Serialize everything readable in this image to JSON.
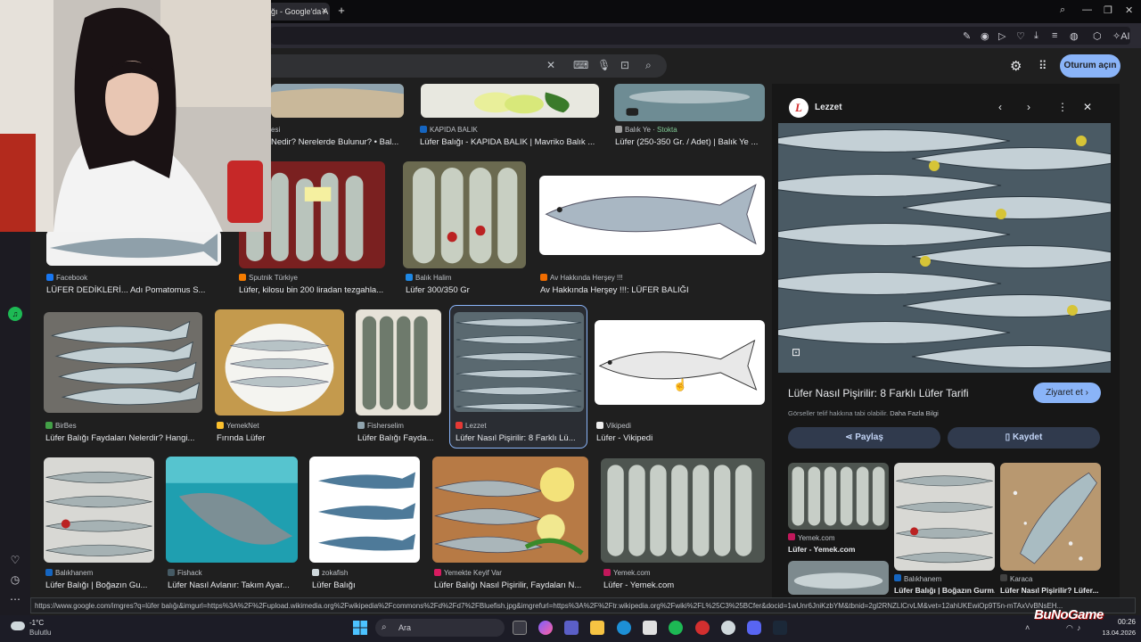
{
  "browser": {
    "tab_title": "ğı - Google'da A",
    "new_tab": "+",
    "sidebar_extra": "AI"
  },
  "google": {
    "signin_label": "Oturum açın"
  },
  "results": [
    {
      "source": "esi",
      "caption": "Nedir? Nerelerde Bulunur? • Bal..."
    },
    {
      "source": "KAPIDA BALIK",
      "caption": "Lüfer Balığı - KAPIDA BALIK | Mavriko Balık ..."
    },
    {
      "source": "Balık Ye",
      "source_extra": "Stokta",
      "caption": "Lüfer (250-350 Gr. / Adet) | Balık Ye ..."
    },
    {
      "source": "Facebook",
      "caption": "LÜFER DEDİKLERİ... Adı Pomatomus S..."
    },
    {
      "source": "Sputnik Türkiye",
      "caption": "Lüfer, kilosu bin 200 liradan tezgahla..."
    },
    {
      "source": "Balık Halim",
      "caption": "Lüfer 300/350 Gr"
    },
    {
      "source": "Av Hakkında Herşey !!!",
      "caption": "Av Hakkında Herşey !!!: LÜFER BALIĞI"
    },
    {
      "source": "BirBes",
      "caption": "Lüfer Balığı Faydaları Nelerdir? Hangi..."
    },
    {
      "source": "YemekNet",
      "caption": "Fırında Lüfer"
    },
    {
      "source": "Fisherselim",
      "caption": "Lüfer Balığı Fayda..."
    },
    {
      "source": "Lezzet",
      "caption": "Lüfer Nasıl Pişirilir: 8 Farklı Lü..."
    },
    {
      "source": "Vikipedi",
      "caption": "Lüfer - Vikipedi"
    },
    {
      "source": "Balıkhanem",
      "caption": "Lüfer Balığı | Boğazın Gu..."
    },
    {
      "source": "Fishack",
      "caption": "Lüfer Nasıl Avlanır: Takım Ayar..."
    },
    {
      "source": "zokafish",
      "caption": "Lüfer Balığı"
    },
    {
      "source": "Yemekte Keyif Var",
      "caption": "Lüfer Balığı Nasıl Pişirilir, Faydaları N..."
    },
    {
      "source": "Yemek.com",
      "caption": "Lüfer - Yemek.com"
    }
  ],
  "panel": {
    "site_name": "Lezzet",
    "logo_letter": "L",
    "title": "Lüfer Nasıl Pişirilir: 8 Farklı Lüfer Tarifi",
    "visit_label": "Ziyaret et",
    "copyright_text": "Görseller telif hakkına tabi olabilir.",
    "learn_more": "Daha Fazla Bilgi",
    "share_label": "Paylaş",
    "save_label": "Kaydet",
    "related": [
      {
        "source": "Yemek.com",
        "title": "Lüfer - Yemek.com"
      },
      {
        "source": "Balıkhanem",
        "title": "Lüfer Balığı | Boğazın Gurm..."
      },
      {
        "source": "Karaca",
        "title": "Lüfer Nasıl Pişirilir? Lüfer..."
      }
    ]
  },
  "status_url": "https://www.google.com/imgres?q=lüfer balığı&imgurl=https%3A%2F%2Fupload.wikimedia.org%2Fwikipedia%2Fcommons%2Fd%2Fd7%2FBluefish.jpg&imgrefurl=https%3A%2F%2Ftr.wikipedia.org%2Fwiki%2FL%25C3%25BCfer&docid=1wUnr6JniKzbYM&tbnid=2gl2RNZLlCrvLM&vet=12ahUKEwiOp9T5n-mTAxVvBNsEH...",
  "taskbar": {
    "temp": "-1°C",
    "condition": "Bulutlu",
    "search_placeholder": "Ara",
    "time": "00:26",
    "date": "13.04.2026",
    "watermark": "BuNoGame"
  }
}
